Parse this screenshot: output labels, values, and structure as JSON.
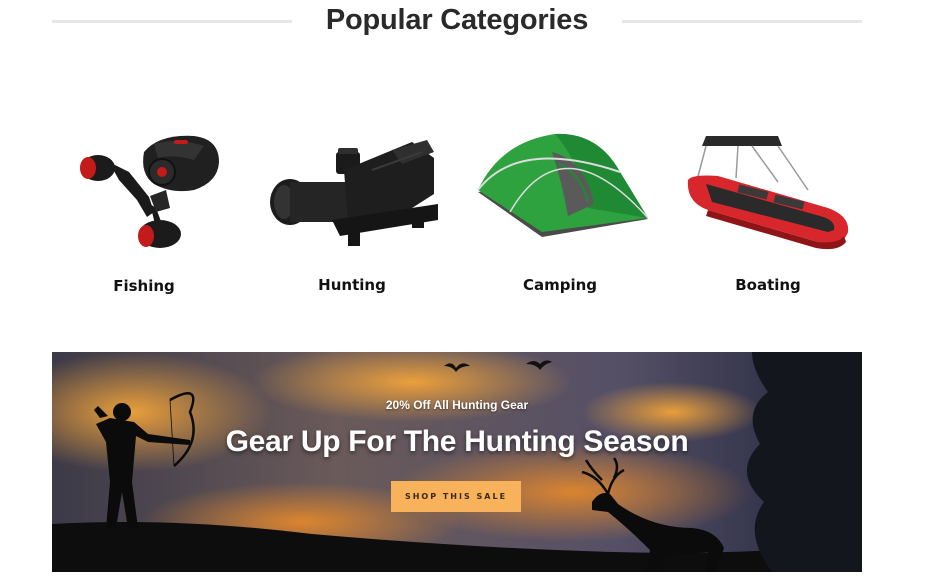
{
  "section": {
    "title": "Popular Categories"
  },
  "categories": [
    {
      "label": "Fishing",
      "icon": "fishing-reel-icon"
    },
    {
      "label": "Hunting",
      "icon": "rifle-scope-icon"
    },
    {
      "label": "Camping",
      "icon": "tent-icon"
    },
    {
      "label": "Boating",
      "icon": "inflatable-boat-icon"
    }
  ],
  "banner": {
    "kicker": "20% Off All Hunting Gear",
    "headline": "Gear Up For The Hunting Season",
    "cta_label": "SHOP THIS SALE",
    "cta_color": "#f8b25b"
  }
}
